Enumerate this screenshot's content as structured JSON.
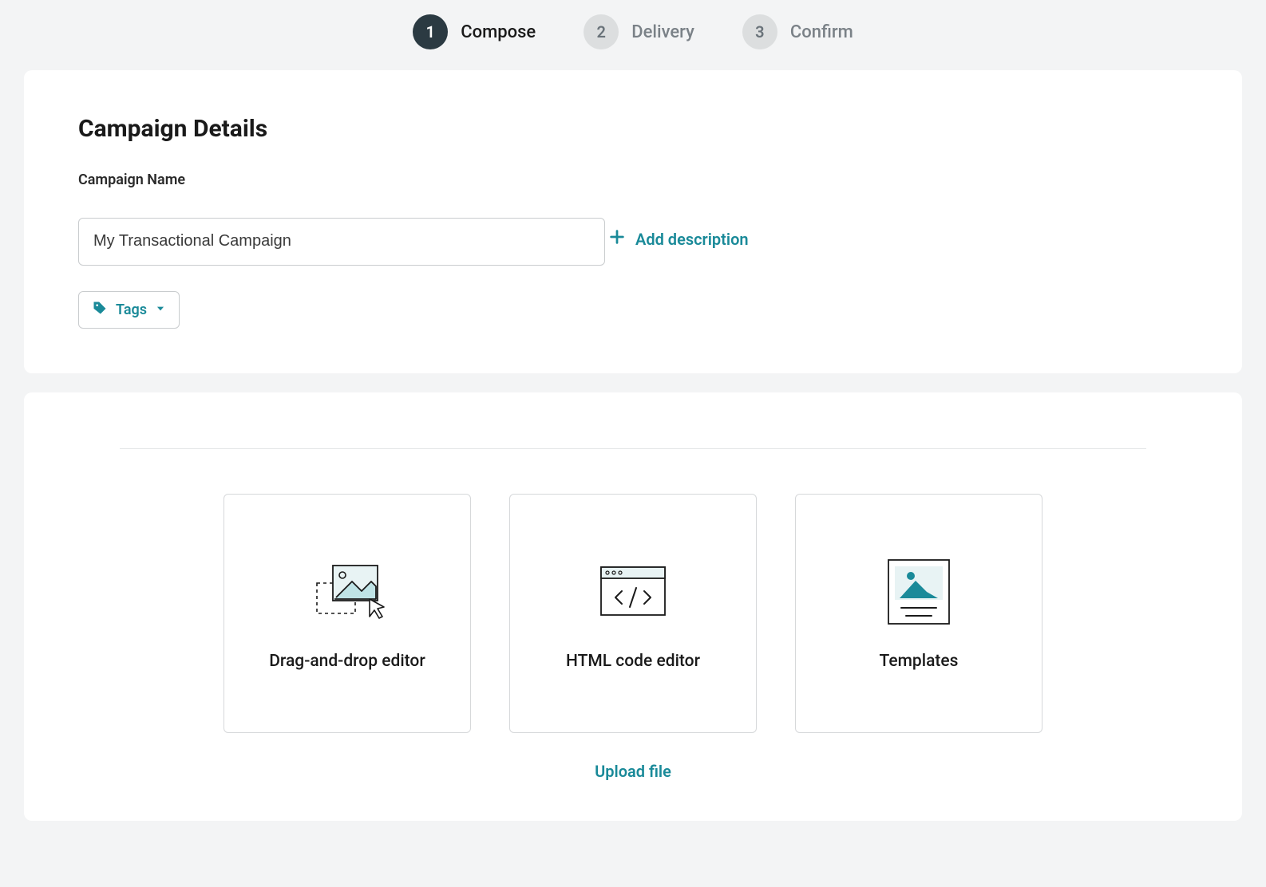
{
  "stepper": {
    "steps": [
      {
        "num": "1",
        "label": "Compose"
      },
      {
        "num": "2",
        "label": "Delivery"
      },
      {
        "num": "3",
        "label": "Confirm"
      }
    ],
    "activeIndex": 0
  },
  "details": {
    "title": "Campaign Details",
    "nameLabel": "Campaign Name",
    "nameValue": "My Transactional Campaign",
    "addDescription": "Add description",
    "tagsLabel": "Tags"
  },
  "editors": {
    "options": [
      {
        "label": "Drag-and-drop editor"
      },
      {
        "label": "HTML code editor"
      },
      {
        "label": "Templates"
      }
    ],
    "uploadLabel": "Upload file"
  },
  "icons": {
    "plus": "plus-icon",
    "tag": "tag-icon",
    "caretDown": "chevron-down-icon",
    "dragDrop": "image-cursor-icon",
    "code": "code-window-icon",
    "templates": "template-icon"
  },
  "colors": {
    "accent": "#1a8a99",
    "stepActiveBg": "#2b3a42",
    "stepInactiveBg": "#dcdedf",
    "cardBg": "#ffffff",
    "pageBg": "#f3f4f5",
    "border": "#c9ccce",
    "illustrationFill": "#bfe3e6"
  }
}
